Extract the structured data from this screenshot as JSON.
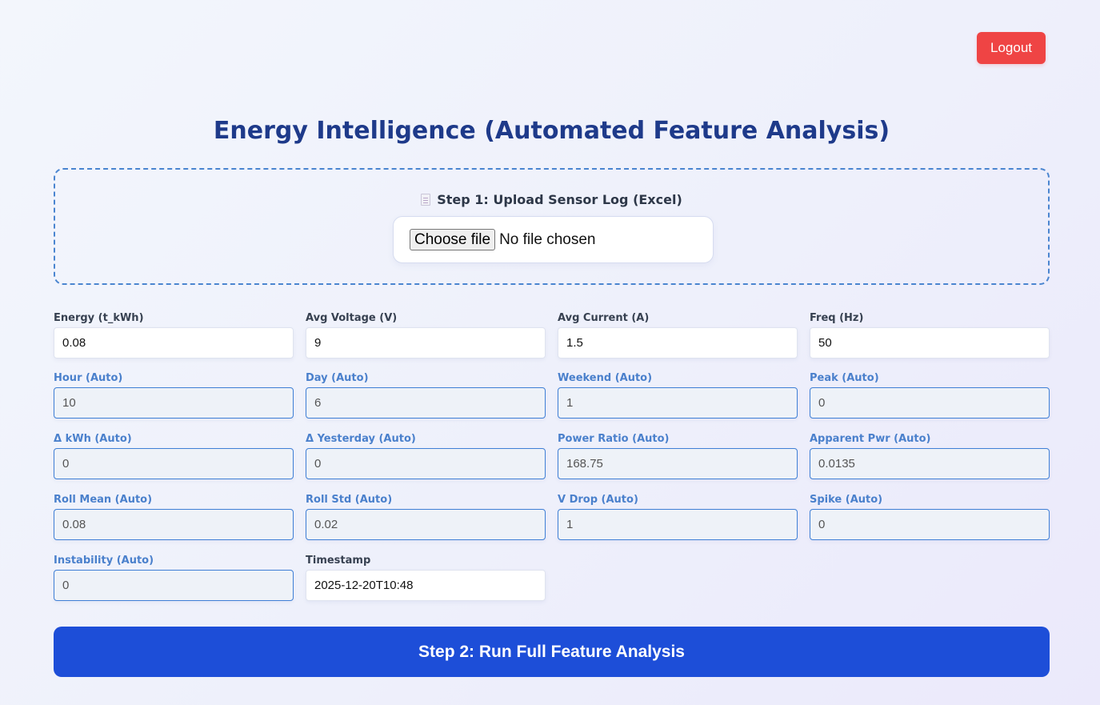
{
  "header": {
    "logout_label": "Logout",
    "title": "Energy Intelligence (Automated Feature Analysis)"
  },
  "upload": {
    "label": "Step 1: Upload Sensor Log (Excel)",
    "icon": "document-icon",
    "button_label": "Choose file",
    "status": "No file chosen"
  },
  "fields": [
    {
      "label": "Energy (t_kWh)",
      "value": "0.08",
      "auto": false
    },
    {
      "label": "Avg Voltage (V)",
      "value": "9",
      "auto": false
    },
    {
      "label": "Avg Current (A)",
      "value": "1.5",
      "auto": false
    },
    {
      "label": "Freq (Hz)",
      "value": "50",
      "auto": false
    },
    {
      "label": "Hour (Auto)",
      "value": "10",
      "auto": true
    },
    {
      "label": "Day (Auto)",
      "value": "6",
      "auto": true
    },
    {
      "label": "Weekend (Auto)",
      "value": "1",
      "auto": true
    },
    {
      "label": "Peak (Auto)",
      "value": "0",
      "auto": true
    },
    {
      "label": "Δ kWh (Auto)",
      "value": "0",
      "auto": true
    },
    {
      "label": "Δ Yesterday (Auto)",
      "value": "0",
      "auto": true
    },
    {
      "label": "Power Ratio (Auto)",
      "value": "168.75",
      "auto": true
    },
    {
      "label": "Apparent Pwr (Auto)",
      "value": "0.0135",
      "auto": true
    },
    {
      "label": "Roll Mean (Auto)",
      "value": "0.08",
      "auto": true
    },
    {
      "label": "Roll Std (Auto)",
      "value": "0.02",
      "auto": true
    },
    {
      "label": "V Drop (Auto)",
      "value": "1",
      "auto": true
    },
    {
      "label": "Spike (Auto)",
      "value": "0",
      "auto": true
    },
    {
      "label": "Instability (Auto)",
      "value": "0",
      "auto": true
    },
    {
      "label": "Timestamp",
      "value": "2025-12-20T10:48",
      "auto": false
    }
  ],
  "actions": {
    "run_label": "Step 2: Run Full Feature Analysis"
  },
  "colors": {
    "logout": "#ef4444",
    "primary": "#1d4ed8",
    "title": "#1e3a8a",
    "auto_label": "#4a80cc",
    "auto_border": "#3f7fd6"
  }
}
